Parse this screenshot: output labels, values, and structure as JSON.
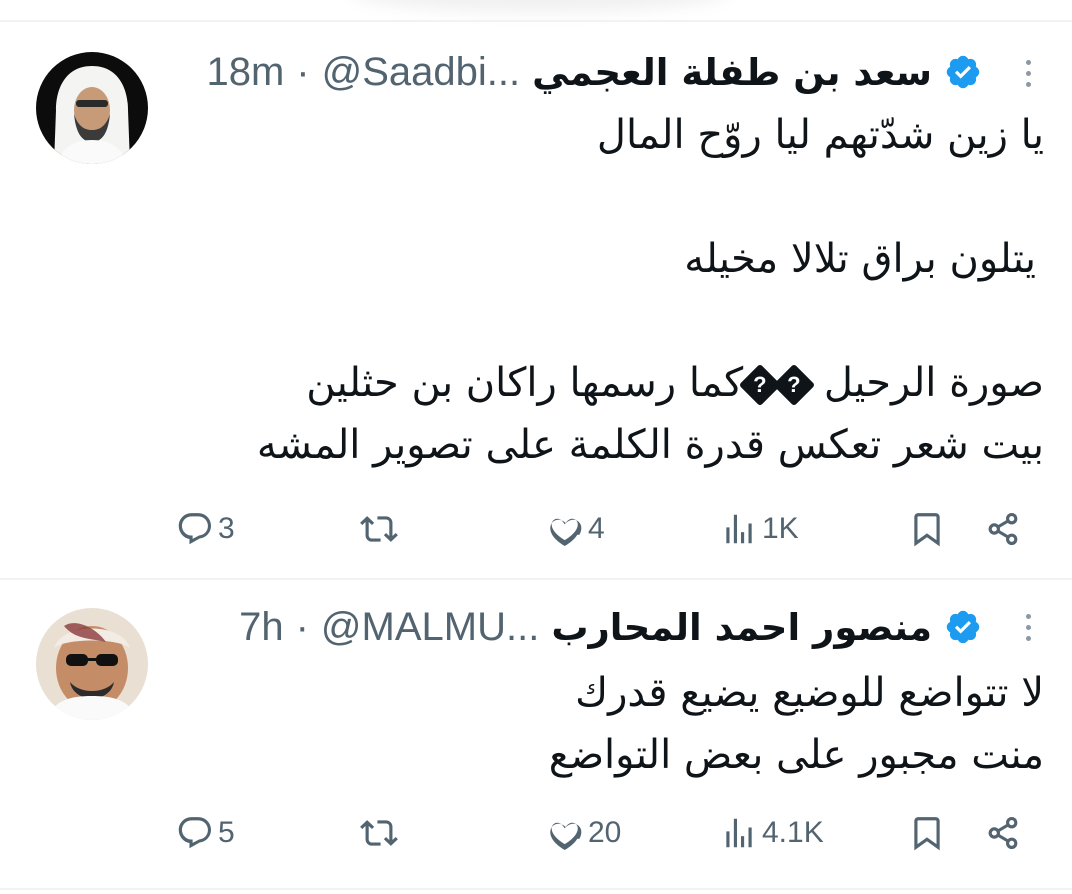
{
  "tweets": [
    {
      "display_name": "سعد بن طفلة العجمي",
      "handle": "@Saadbi...",
      "separator": "·",
      "time": "18m",
      "lines": [
        "يا زين شدّتهم ليا روّح المال",
        "",
        "يتلون براق تلالا مخيله",
        "",
        "صورة الرحيل",
        "كما رسمها راكان بن حثلين",
        "بيت شعر تعكس قدرة الكلمة على تصوير المشه"
      ],
      "replacement_char": "?",
      "stats": {
        "replies": "3",
        "reposts": "",
        "likes": "4",
        "views": "1K"
      }
    },
    {
      "display_name": "منصور احمد المحارب",
      "handle": "@MALMU...",
      "separator": "·",
      "time": "7h",
      "lines": [
        "لا تتواضع للوضيع يضيع قدرك",
        "منت مجبور على بعض التواضع"
      ],
      "stats": {
        "replies": "5",
        "reposts": "",
        "likes": "20",
        "views": "4.1K"
      }
    }
  ],
  "icons": {
    "verified": "verified-badge-icon",
    "more": "more-dots-icon",
    "reply": "reply-icon",
    "repost": "repost-icon",
    "like": "like-icon",
    "views": "views-icon",
    "bookmark": "bookmark-icon",
    "share": "share-icon"
  },
  "colors": {
    "verified": "#1d9bf0",
    "text": "#0f1419",
    "secondary": "#536471",
    "divider": "#eff3f4"
  }
}
